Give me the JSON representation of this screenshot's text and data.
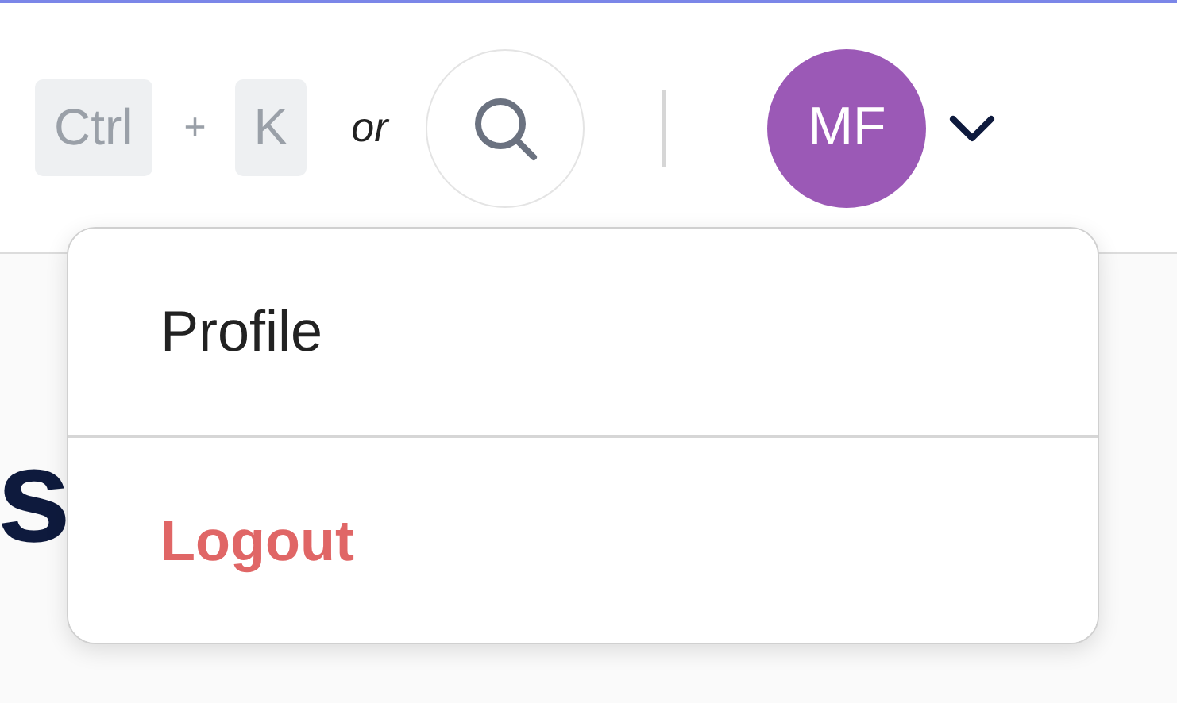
{
  "header": {
    "shortcut_keys": [
      "Ctrl",
      "K"
    ],
    "plus": "+",
    "or": "or",
    "avatar": {
      "initials": "MF"
    }
  },
  "page": {
    "heading": "s"
  },
  "menu": {
    "expanded": true,
    "items": [
      {
        "label": "Profile",
        "kind": "normal"
      },
      {
        "label": "Logout",
        "kind": "danger"
      }
    ]
  }
}
